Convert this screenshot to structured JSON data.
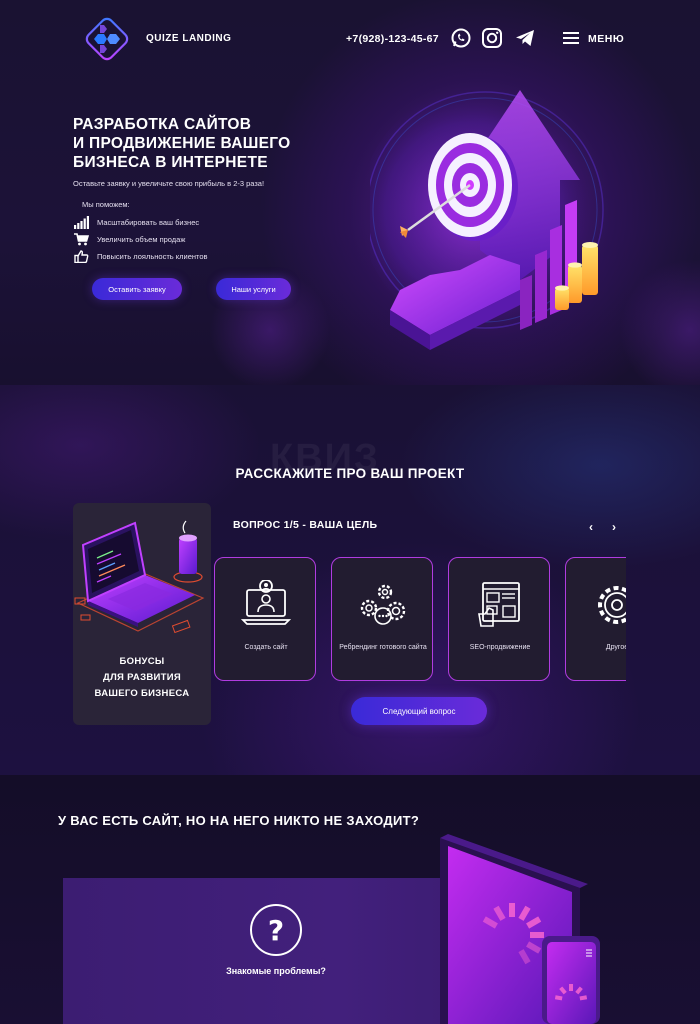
{
  "header": {
    "logo_text": "QUIZE LANDING",
    "phone": "+7(928)-123-45-67",
    "social_icons": [
      "whatsapp-icon",
      "instagram-icon",
      "telegram-icon"
    ],
    "menu_label": "МЕНЮ"
  },
  "hero": {
    "title_lines": [
      "РАЗРАБОТКА САЙТОВ",
      "И ПРОДВИЖЕНИЕ ВАШЕГО",
      "БИЗНЕСА В ИНТЕРНЕТЕ"
    ],
    "subtitle": "Оставьте заявку и увеличьте свою прибыль в 2-3 раза!",
    "help_label": "Мы поможем:",
    "benefits": [
      {
        "icon": "signal-bars-icon",
        "label": "Масштабировать ваш бизнес"
      },
      {
        "icon": "cart-icon",
        "label": "Увеличить объем продаж"
      },
      {
        "icon": "thumbs-up-icon",
        "label": "Повысить лояльность клиентов"
      }
    ],
    "cta_primary": "Оставить заявку",
    "cta_secondary": "Наши услуги"
  },
  "quiz": {
    "watermark": "КВИЗ",
    "section_title": "РАССКАЖИТЕ ПРО ВАШ ПРОЕКТ",
    "bonus_lines": [
      "БОНУСЫ",
      "ДЛЯ РАЗВИТИЯ",
      "ВАШЕГО БИЗНЕСА"
    ],
    "question_title": "ВОПРОС 1/5 - ВАША ЦЕЛЬ",
    "prev_arrow": "‹",
    "next_arrow": "›",
    "options": [
      {
        "icon": "laptop-user-icon",
        "label": "Создать сайт"
      },
      {
        "icon": "gears-icon",
        "label": "Ребрендинг готового сайта"
      },
      {
        "icon": "seo-dashboard-icon",
        "label": "SEO-продвижение"
      },
      {
        "icon": "gear-icon",
        "label": "Другое"
      }
    ],
    "next_button": "Следующий вопрос"
  },
  "problems": {
    "title": "У ВАС ЕСТЬ САЙТ, НО НА НЕГО НИКТО НЕ ЗАХОДИТ?",
    "question_mark": "?",
    "label": "Знакомые проблемы?"
  },
  "colors": {
    "accent_blue": "#3a2ad8",
    "accent_purple": "#6a2bd9",
    "card_border": "#b03ce0",
    "background": "#150e28"
  }
}
